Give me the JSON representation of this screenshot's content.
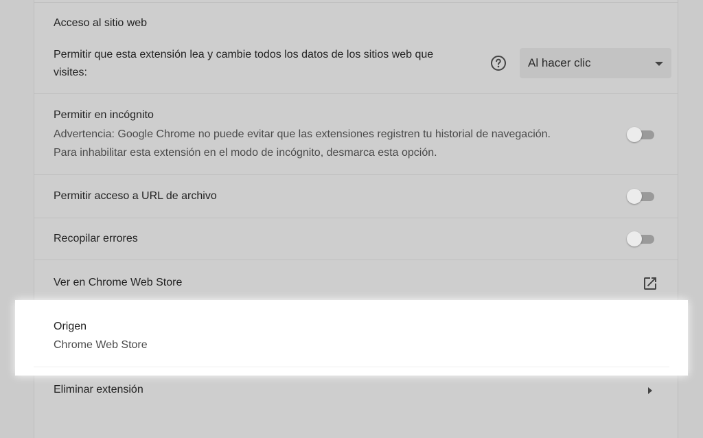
{
  "site_access": {
    "title": "Acceso al sitio web",
    "description": "Permitir que esta extensión lea y cambie todos los datos de los sitios web que",
    "description_cont": "visites:",
    "select_value": "Al hacer clic"
  },
  "incognito": {
    "title": "Permitir en incógnito",
    "warning_line1": "Advertencia: Google Chrome no puede evitar que las extensiones registren tu historial de navegación.",
    "warning_line2": "Para inhabilitar esta extensión en el modo de incógnito, desmarca esta opción.",
    "enabled": false
  },
  "file_urls": {
    "title": "Permitir acceso a URL de archivo",
    "enabled": false
  },
  "errors": {
    "title": "Recopilar errores",
    "enabled": false
  },
  "web_store": {
    "title": "Ver en Chrome Web Store"
  },
  "origin": {
    "title": "Origen",
    "value": "Chrome Web Store"
  },
  "remove": {
    "title": "Eliminar extensión"
  }
}
